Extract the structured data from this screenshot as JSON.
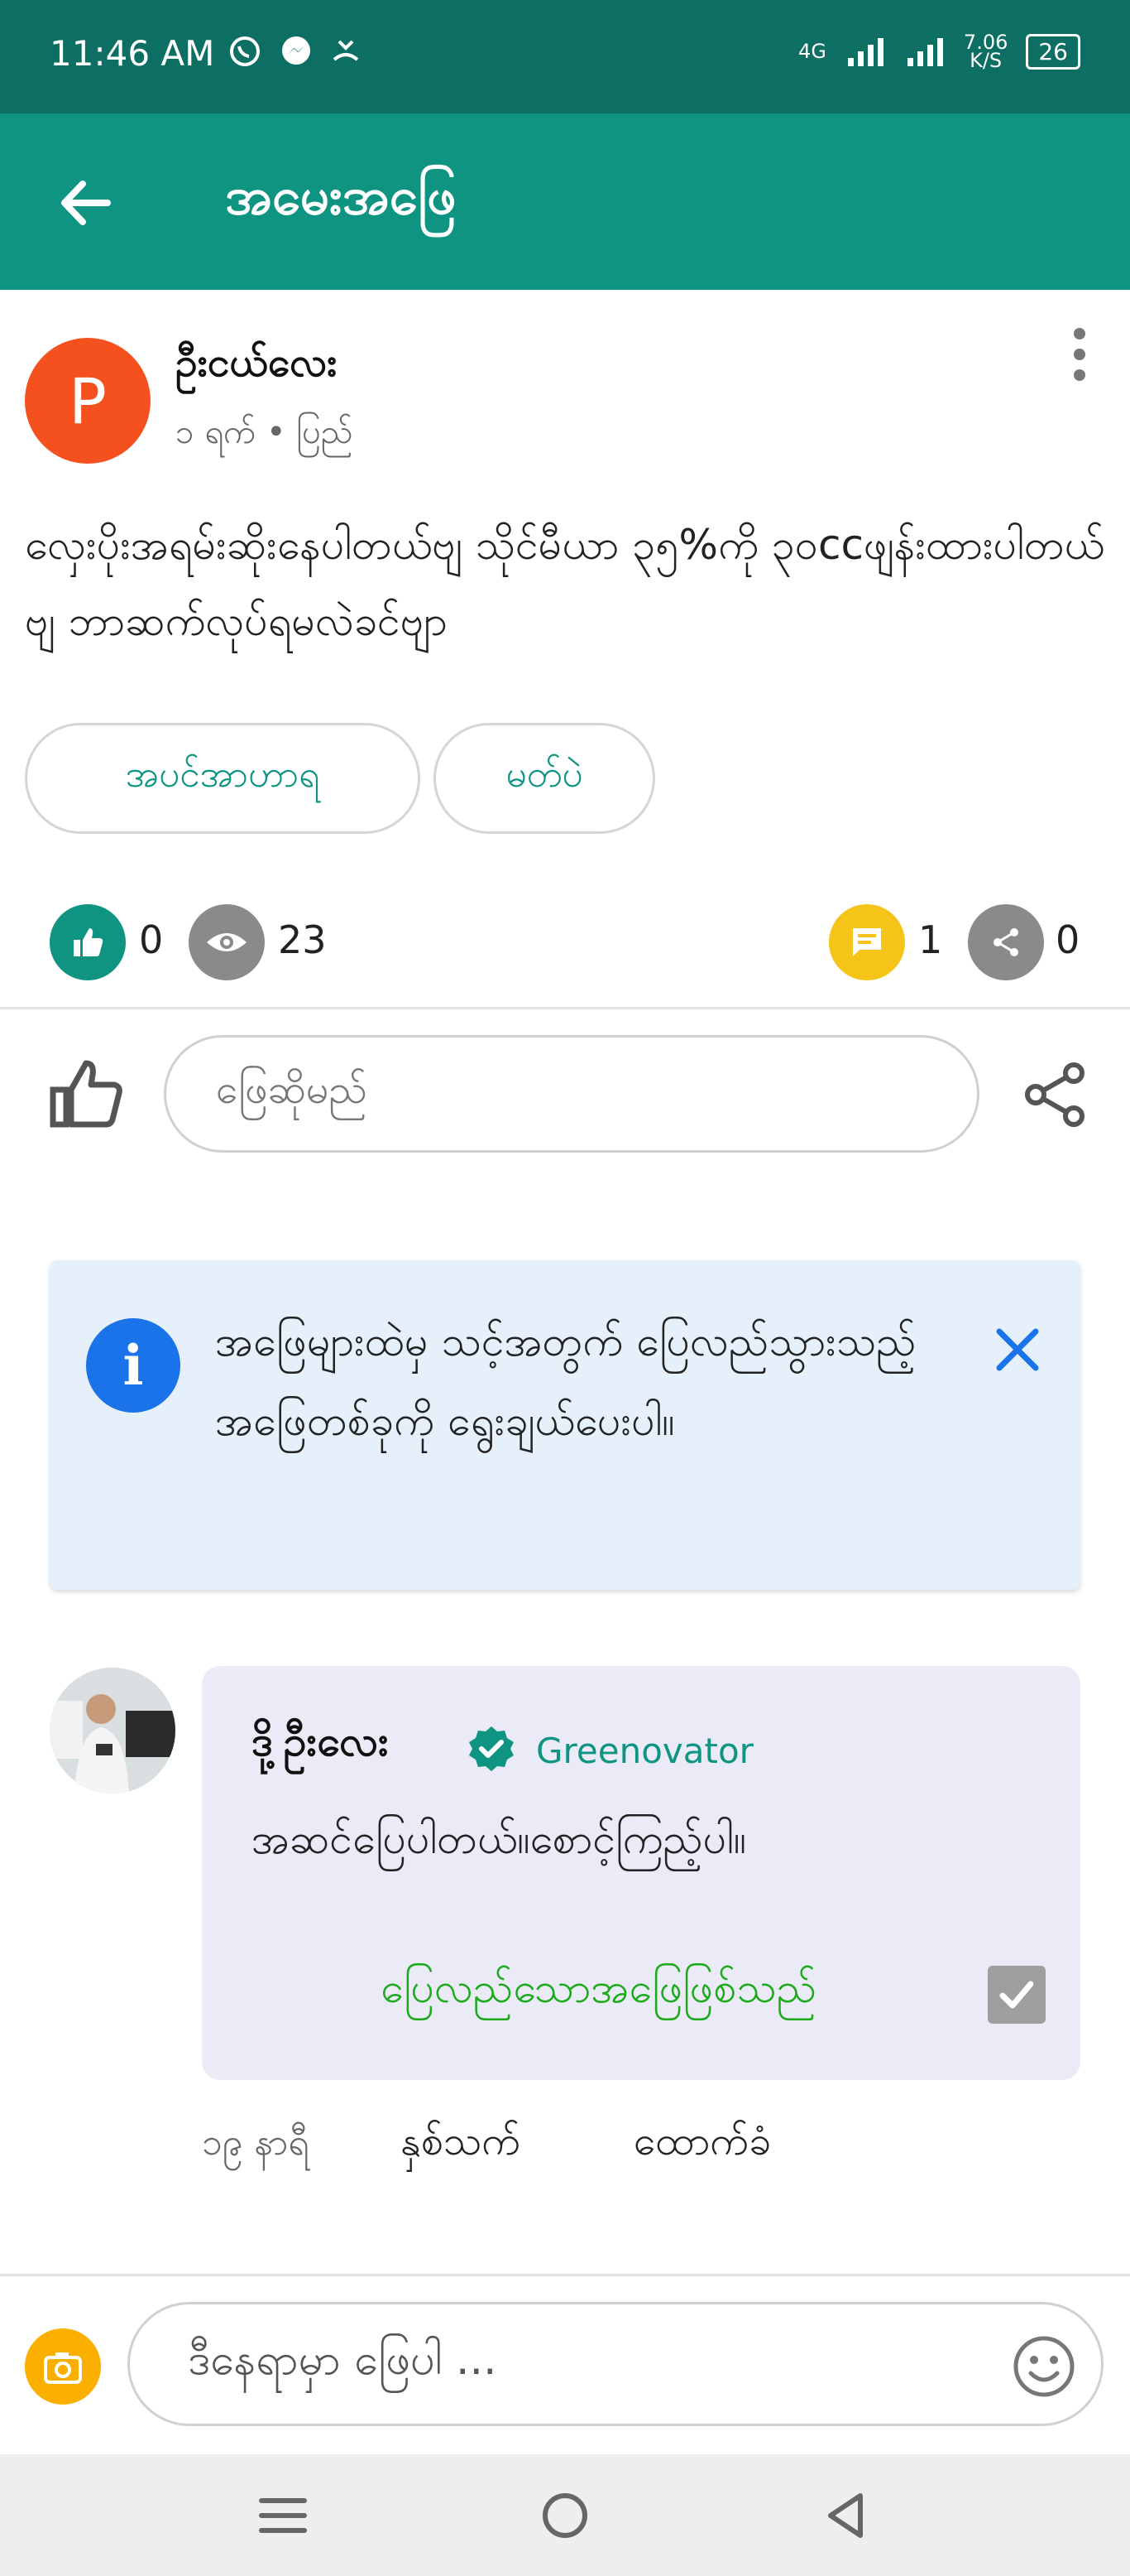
{
  "status_bar": {
    "time": "11:46 AM",
    "network_1": "4G",
    "speed_value": "7.06",
    "speed_unit": "K/S",
    "battery": "26"
  },
  "app_bar": {
    "title": "အမေးအဖြေ"
  },
  "post": {
    "avatar_letter": "P",
    "author": "ဦးငယ်လေး",
    "meta": "၁ ရက် • ပြည်",
    "question": "လှေးပိုးအရမ်းဆိုးနေပါတယ်ဗျ သိုင်မီယာ ၃၅%ကို ၃၀ccဖျန်းထားပါတယ်ဗျ ဘာဆက်လုပ်ရမလဲခင်ဗျာ",
    "tags": [
      "အပင်အာဟာရ",
      "မတ်ပဲ"
    ],
    "stats": {
      "likes": "0",
      "views": "23",
      "comments": "1",
      "shares": "0"
    },
    "reply_placeholder": "ဖြေဆိုမည်"
  },
  "info_banner": {
    "text": "အဖြေများထဲမှ သင့်အတွက် ပြေလည်သွားသည့် အဖြေတစ်ခုကို ရွေးချယ်ပေးပါ။"
  },
  "answer": {
    "author": "ဒို့ဦးလေး",
    "badge": "Greenovator",
    "text": "အဆင်ပြေပါတယ်။စောင့်ကြည့်ပါ။",
    "accepted_label": "ပြေလည်သောအဖြေဖြစ်သည်",
    "time": "၁၉ နာရီ",
    "like_action": "နှစ်သက်",
    "support_action": "ထောက်ခံ"
  },
  "composer": {
    "placeholder": "ဒီနေရာမှာ ဖြေပါ ..."
  },
  "colors": {
    "status_bar": "#0d6f63",
    "app_bar": "#0f9482",
    "avatar": "#f4511e",
    "info_blue": "#1a73e8",
    "accepted_green": "#1aaa1a",
    "comment_yellow": "#f4c518"
  }
}
